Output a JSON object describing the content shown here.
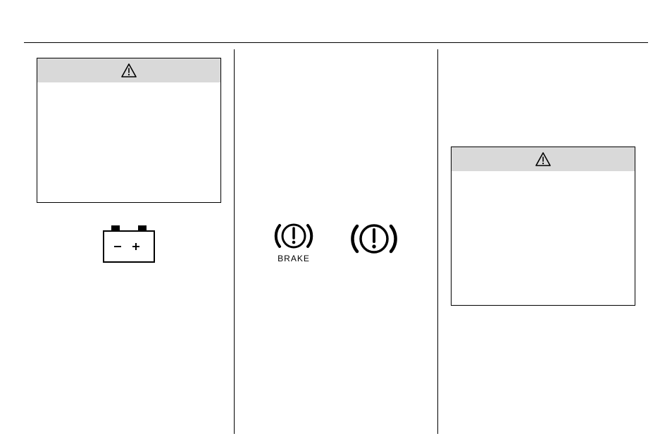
{
  "icons": {
    "brake1_label": "BRAKE"
  }
}
